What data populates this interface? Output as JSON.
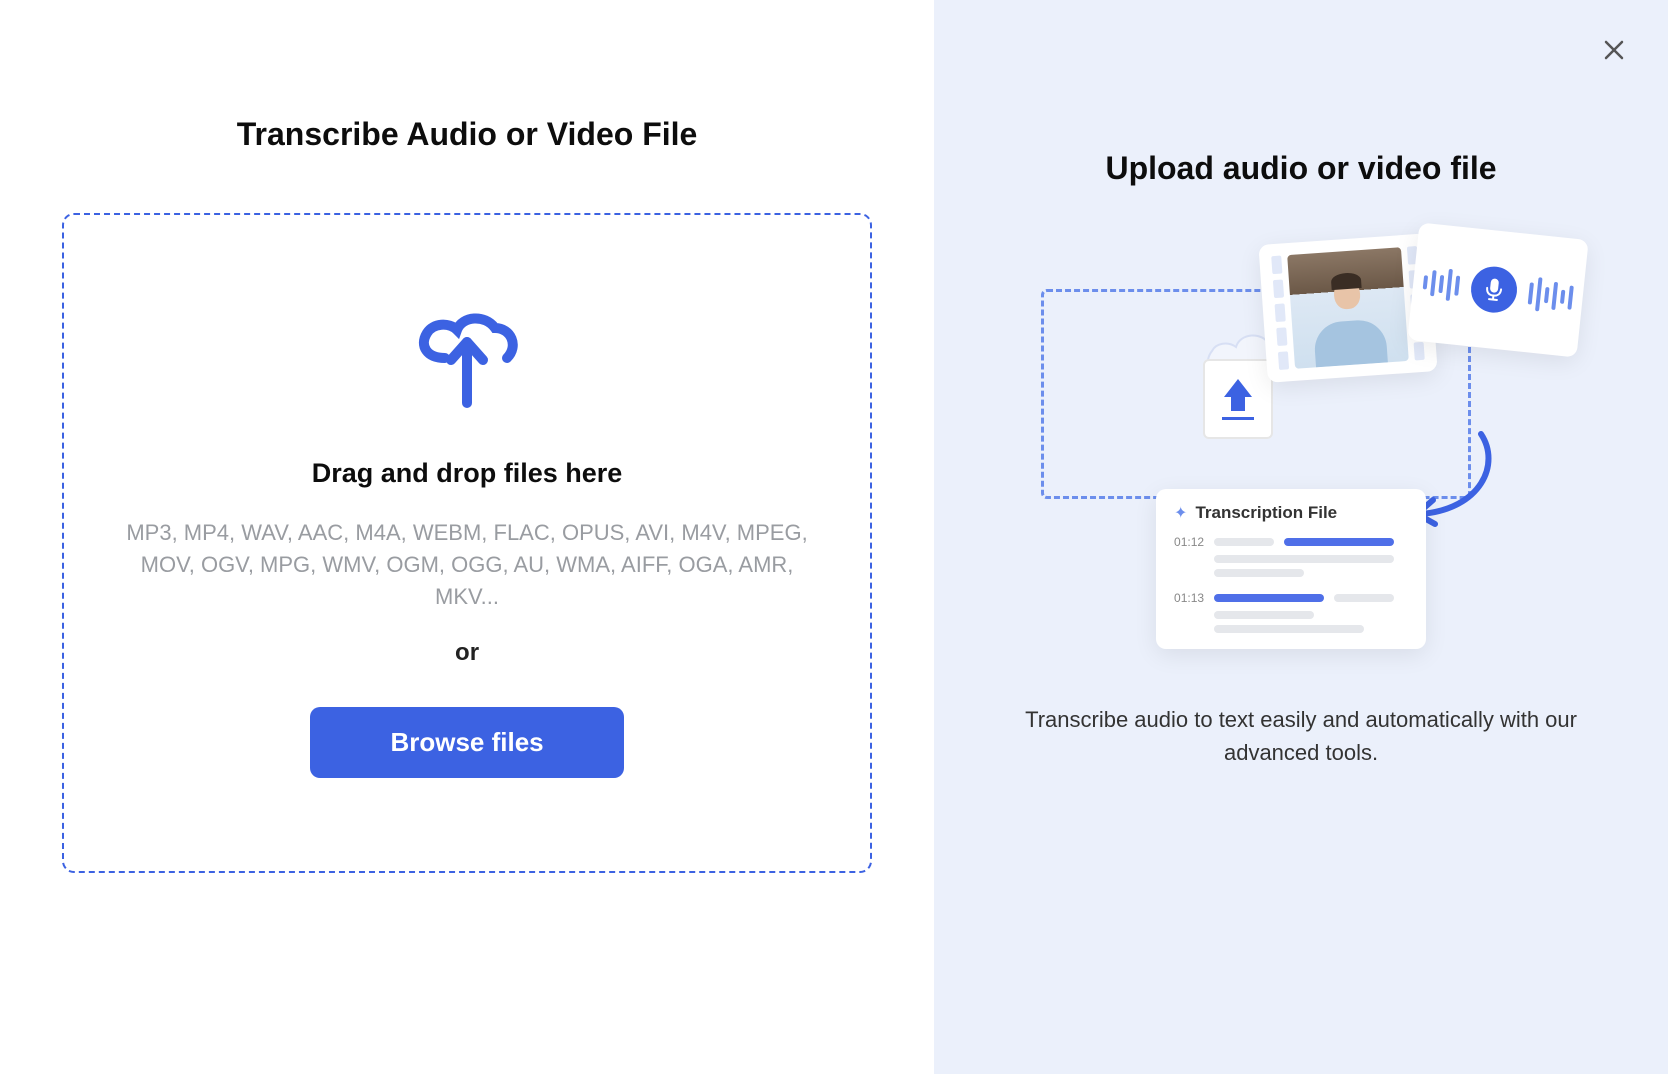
{
  "left": {
    "title": "Transcribe Audio or Video File",
    "drop_heading": "Drag and drop files here",
    "formats": "MP3, MP4, WAV, AAC, M4A, WEBM, FLAC, OPUS, AVI, M4V, MPEG, MOV, OGV, MPG, WMV, OGM, OGG, AU, WMA, AIFF, OGA, AMR, MKV...",
    "or": "or",
    "browse_label": "Browse files"
  },
  "right": {
    "title": "Upload audio or video file",
    "transcript_title": "Transcription File",
    "timestamps": [
      "01:12",
      "01:13"
    ],
    "description": "Transcribe audio to text easily and automatically with our advanced tools."
  }
}
